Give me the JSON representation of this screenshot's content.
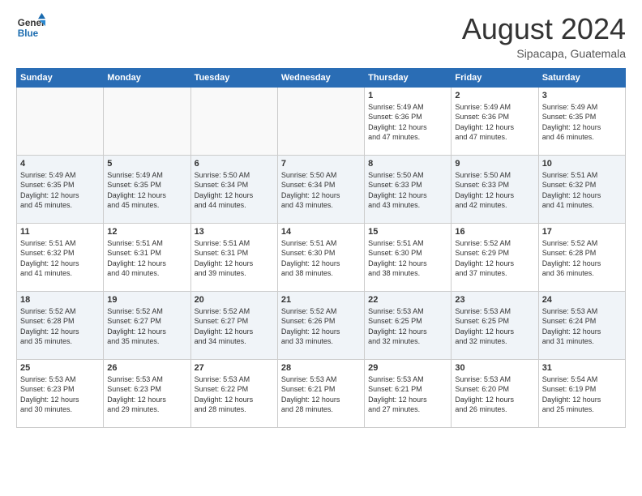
{
  "header": {
    "logo_line1": "General",
    "logo_line2": "Blue",
    "month_year": "August 2024",
    "location": "Sipacapa, Guatemala"
  },
  "weekdays": [
    "Sunday",
    "Monday",
    "Tuesday",
    "Wednesday",
    "Thursday",
    "Friday",
    "Saturday"
  ],
  "weeks": [
    [
      {
        "day": "",
        "info": ""
      },
      {
        "day": "",
        "info": ""
      },
      {
        "day": "",
        "info": ""
      },
      {
        "day": "",
        "info": ""
      },
      {
        "day": "1",
        "info": "Sunrise: 5:49 AM\nSunset: 6:36 PM\nDaylight: 12 hours\nand 47 minutes."
      },
      {
        "day": "2",
        "info": "Sunrise: 5:49 AM\nSunset: 6:36 PM\nDaylight: 12 hours\nand 47 minutes."
      },
      {
        "day": "3",
        "info": "Sunrise: 5:49 AM\nSunset: 6:35 PM\nDaylight: 12 hours\nand 46 minutes."
      }
    ],
    [
      {
        "day": "4",
        "info": "Sunrise: 5:49 AM\nSunset: 6:35 PM\nDaylight: 12 hours\nand 45 minutes."
      },
      {
        "day": "5",
        "info": "Sunrise: 5:49 AM\nSunset: 6:35 PM\nDaylight: 12 hours\nand 45 minutes."
      },
      {
        "day": "6",
        "info": "Sunrise: 5:50 AM\nSunset: 6:34 PM\nDaylight: 12 hours\nand 44 minutes."
      },
      {
        "day": "7",
        "info": "Sunrise: 5:50 AM\nSunset: 6:34 PM\nDaylight: 12 hours\nand 43 minutes."
      },
      {
        "day": "8",
        "info": "Sunrise: 5:50 AM\nSunset: 6:33 PM\nDaylight: 12 hours\nand 43 minutes."
      },
      {
        "day": "9",
        "info": "Sunrise: 5:50 AM\nSunset: 6:33 PM\nDaylight: 12 hours\nand 42 minutes."
      },
      {
        "day": "10",
        "info": "Sunrise: 5:51 AM\nSunset: 6:32 PM\nDaylight: 12 hours\nand 41 minutes."
      }
    ],
    [
      {
        "day": "11",
        "info": "Sunrise: 5:51 AM\nSunset: 6:32 PM\nDaylight: 12 hours\nand 41 minutes."
      },
      {
        "day": "12",
        "info": "Sunrise: 5:51 AM\nSunset: 6:31 PM\nDaylight: 12 hours\nand 40 minutes."
      },
      {
        "day": "13",
        "info": "Sunrise: 5:51 AM\nSunset: 6:31 PM\nDaylight: 12 hours\nand 39 minutes."
      },
      {
        "day": "14",
        "info": "Sunrise: 5:51 AM\nSunset: 6:30 PM\nDaylight: 12 hours\nand 38 minutes."
      },
      {
        "day": "15",
        "info": "Sunrise: 5:51 AM\nSunset: 6:30 PM\nDaylight: 12 hours\nand 38 minutes."
      },
      {
        "day": "16",
        "info": "Sunrise: 5:52 AM\nSunset: 6:29 PM\nDaylight: 12 hours\nand 37 minutes."
      },
      {
        "day": "17",
        "info": "Sunrise: 5:52 AM\nSunset: 6:28 PM\nDaylight: 12 hours\nand 36 minutes."
      }
    ],
    [
      {
        "day": "18",
        "info": "Sunrise: 5:52 AM\nSunset: 6:28 PM\nDaylight: 12 hours\nand 35 minutes."
      },
      {
        "day": "19",
        "info": "Sunrise: 5:52 AM\nSunset: 6:27 PM\nDaylight: 12 hours\nand 35 minutes."
      },
      {
        "day": "20",
        "info": "Sunrise: 5:52 AM\nSunset: 6:27 PM\nDaylight: 12 hours\nand 34 minutes."
      },
      {
        "day": "21",
        "info": "Sunrise: 5:52 AM\nSunset: 6:26 PM\nDaylight: 12 hours\nand 33 minutes."
      },
      {
        "day": "22",
        "info": "Sunrise: 5:53 AM\nSunset: 6:25 PM\nDaylight: 12 hours\nand 32 minutes."
      },
      {
        "day": "23",
        "info": "Sunrise: 5:53 AM\nSunset: 6:25 PM\nDaylight: 12 hours\nand 32 minutes."
      },
      {
        "day": "24",
        "info": "Sunrise: 5:53 AM\nSunset: 6:24 PM\nDaylight: 12 hours\nand 31 minutes."
      }
    ],
    [
      {
        "day": "25",
        "info": "Sunrise: 5:53 AM\nSunset: 6:23 PM\nDaylight: 12 hours\nand 30 minutes."
      },
      {
        "day": "26",
        "info": "Sunrise: 5:53 AM\nSunset: 6:23 PM\nDaylight: 12 hours\nand 29 minutes."
      },
      {
        "day": "27",
        "info": "Sunrise: 5:53 AM\nSunset: 6:22 PM\nDaylight: 12 hours\nand 28 minutes."
      },
      {
        "day": "28",
        "info": "Sunrise: 5:53 AM\nSunset: 6:21 PM\nDaylight: 12 hours\nand 28 minutes."
      },
      {
        "day": "29",
        "info": "Sunrise: 5:53 AM\nSunset: 6:21 PM\nDaylight: 12 hours\nand 27 minutes."
      },
      {
        "day": "30",
        "info": "Sunrise: 5:53 AM\nSunset: 6:20 PM\nDaylight: 12 hours\nand 26 minutes."
      },
      {
        "day": "31",
        "info": "Sunrise: 5:54 AM\nSunset: 6:19 PM\nDaylight: 12 hours\nand 25 minutes."
      }
    ]
  ]
}
